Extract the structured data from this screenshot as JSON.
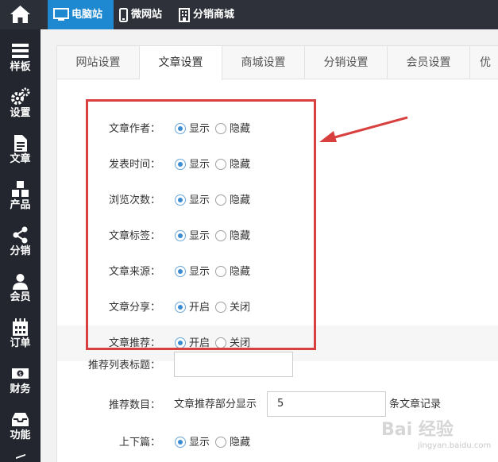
{
  "topbar": {
    "tabs": [
      {
        "label": "电脑站",
        "icon": "monitor-icon"
      },
      {
        "label": "微网站",
        "icon": "mobile-icon"
      },
      {
        "label": "分销商城",
        "icon": "building-icon"
      }
    ]
  },
  "sidebar": {
    "items": [
      {
        "label": "样板",
        "icon": "template-icon"
      },
      {
        "label": "设置",
        "icon": "gears-icon"
      },
      {
        "label": "文章",
        "icon": "document-icon"
      },
      {
        "label": "产品",
        "icon": "cubes-icon"
      },
      {
        "label": "分销",
        "icon": "share-icon"
      },
      {
        "label": "会员",
        "icon": "user-icon"
      },
      {
        "label": "订单",
        "icon": "calendar-icon"
      },
      {
        "label": "财务",
        "icon": "money-icon"
      },
      {
        "label": "功能",
        "icon": "inbox-icon"
      }
    ]
  },
  "tabs": [
    "网站设置",
    "文章设置",
    "商城设置",
    "分销设置",
    "会员设置",
    "优"
  ],
  "settings": [
    {
      "label": "文章作者：",
      "opt1": "显示",
      "opt2": "隐藏",
      "selected": 1
    },
    {
      "label": "发表时间：",
      "opt1": "显示",
      "opt2": "隐藏",
      "selected": 1
    },
    {
      "label": "浏览次数：",
      "opt1": "显示",
      "opt2": "隐藏",
      "selected": 1
    },
    {
      "label": "文章标签：",
      "opt1": "显示",
      "opt2": "隐藏",
      "selected": 1
    },
    {
      "label": "文章来源：",
      "opt1": "显示",
      "opt2": "隐藏",
      "selected": 1
    },
    {
      "label": "文章分享：",
      "opt1": "开启",
      "opt2": "关闭",
      "selected": 1
    },
    {
      "label": "文章推荐：",
      "opt1": "开启",
      "opt2": "关闭",
      "selected": 1
    }
  ],
  "recommend_title": {
    "label": "推荐列表标题：",
    "value": ""
  },
  "recommend_count": {
    "label": "推荐数目：",
    "prefix": "文章推荐部分显示",
    "value": "5",
    "suffix": "条文章记录"
  },
  "prevnext": {
    "label": "上下篇：",
    "opt1": "显示",
    "opt2": "隐藏",
    "selected": 1
  },
  "watermark": {
    "text": "Bai 经验",
    "url": "jingyan.baidu.com"
  },
  "colors": {
    "accent": "#1e88d0",
    "highlight": "#d8403f",
    "sidebar": "#23262e"
  }
}
